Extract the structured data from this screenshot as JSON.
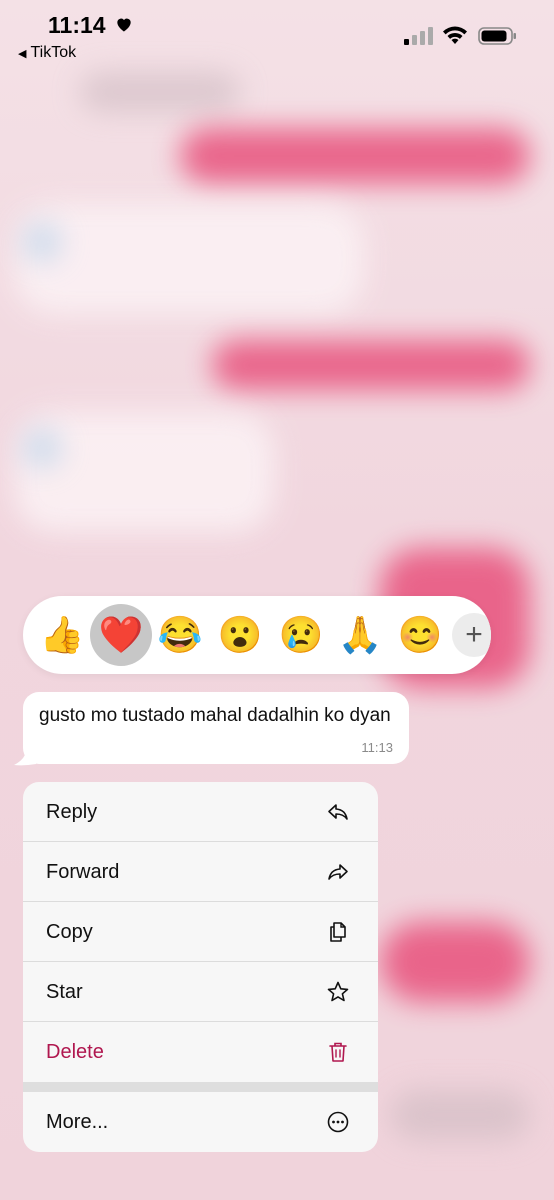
{
  "status_bar": {
    "time": "11:14",
    "back_app": "TikTok"
  },
  "reactions": {
    "emojis": [
      "👍",
      "❤️",
      "😂",
      "😮",
      "😢",
      "🙏",
      "😊"
    ],
    "selected_index": 1,
    "more_label": "+"
  },
  "message": {
    "text": "gusto mo tustado mahal dadalhin ko dyan",
    "time": "11:13"
  },
  "menu": {
    "items": [
      {
        "label": "Reply",
        "icon": "reply-icon"
      },
      {
        "label": "Forward",
        "icon": "forward-icon"
      },
      {
        "label": "Copy",
        "icon": "copy-icon"
      },
      {
        "label": "Star",
        "icon": "star-icon"
      },
      {
        "label": "Delete",
        "icon": "trash-icon"
      },
      {
        "label": "More...",
        "icon": "more-icon"
      }
    ]
  },
  "colors": {
    "delete": "#b0174f",
    "outgoing_bubble": "#e8517c",
    "background": "#f3dde3"
  }
}
